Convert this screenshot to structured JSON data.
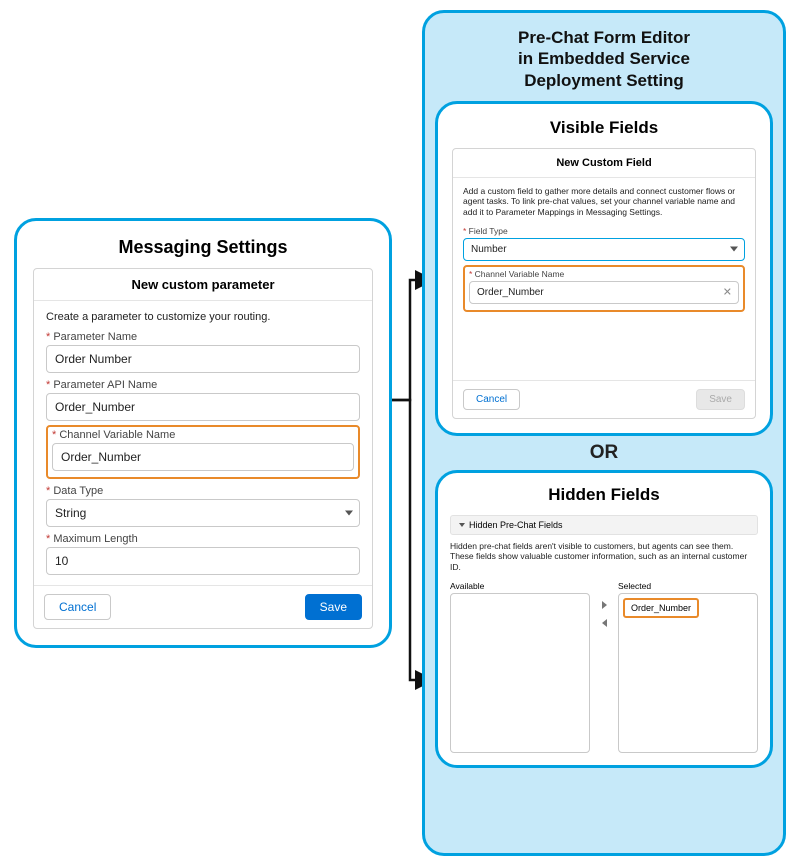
{
  "left": {
    "title": "Messaging Settings",
    "dialog_title": "New custom parameter",
    "intro": "Create a parameter to customize your routing.",
    "param_name_label": "Parameter Name",
    "param_name_value": "Order Number",
    "api_name_label": "Parameter API Name",
    "api_name_value": "Order_Number",
    "cvn_label": "Channel Variable Name",
    "cvn_value": "Order_Number",
    "data_type_label": "Data Type",
    "data_type_value": "String",
    "max_len_label": "Maximum Length",
    "max_len_value": "10",
    "cancel": "Cancel",
    "save": "Save"
  },
  "right": {
    "region_title_l1": "Pre-Chat Form Editor",
    "region_title_l2": "in Embedded Service",
    "region_title_l3": "Deployment Setting",
    "or": "OR",
    "visible": {
      "title": "Visible Fields",
      "dialog_title": "New Custom Field",
      "intro": "Add a custom field to gather more details and connect customer flows or agent tasks. To link pre-chat values, set your channel variable name and add it to Parameter Mappings in Messaging Settings.",
      "field_type_label": "Field Type",
      "field_type_value": "Number",
      "cvn_label": "Channel Variable Name",
      "cvn_value": "Order_Number",
      "cancel": "Cancel",
      "save": "Save"
    },
    "hidden": {
      "title": "Hidden Fields",
      "section_title": "Hidden Pre-Chat Fields",
      "desc": "Hidden pre-chat fields aren't visible to customers, but agents can see them. These fields show valuable customer information, such as an internal customer ID.",
      "available_label": "Available",
      "selected_label": "Selected",
      "selected_item": "Order_Number"
    }
  }
}
